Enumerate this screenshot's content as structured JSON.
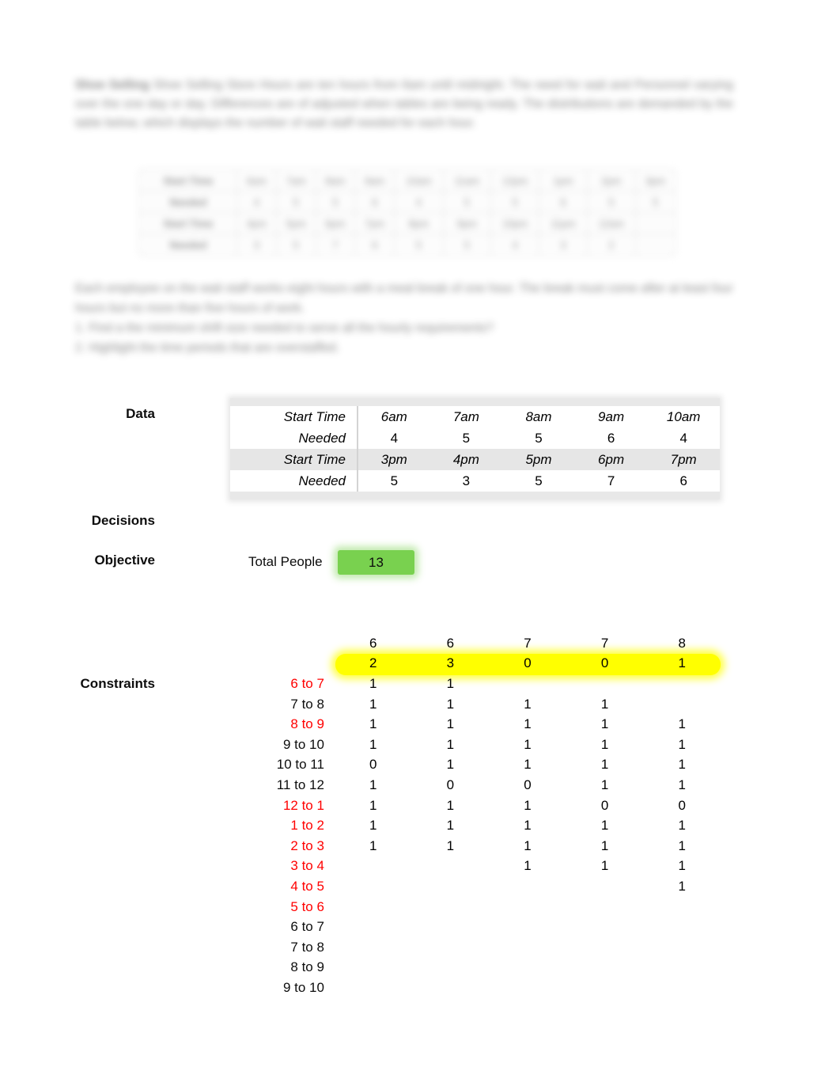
{
  "intro": {
    "lead_bold": "Shoe Selling",
    "paragraph": "Shoe Selling Store Hours are ten hours from 6am until midnight. The need for wait and Personnel varying over the one day or day. Differences are of adjusted when tables are being ready. The distributions are demanded by the table below, which displays the number of wait staff needed for each hour.",
    "questions_paragraph": "Each employee on the wait staff works eight hours with a meal break of one hour. The break must come after at least four hours but no more than five hours of work.",
    "q1": "1. Find a the minimum shift size needed to serve all the hourly requirements?",
    "q2": "2. Highlight the time periods that are overstaffed."
  },
  "blurred_table": {
    "row1_label": "Start Time",
    "row1": [
      "6am",
      "7am",
      "8am",
      "9am",
      "10am",
      "11am",
      "12pm",
      "1pm",
      "2pm",
      "3pm"
    ],
    "row2_label": "Needed",
    "row2": [
      "4",
      "5",
      "5",
      "6",
      "4",
      "5",
      "5",
      "6",
      "5",
      "5"
    ],
    "row3_label": "Start Time",
    "row3": [
      "4pm",
      "5pm",
      "6pm",
      "7pm",
      "8pm",
      "9pm",
      "10pm",
      "11pm",
      "12am"
    ],
    "row4_label": "Needed",
    "row4": [
      "3",
      "5",
      "7",
      "6",
      "5",
      "5",
      "4",
      "3",
      "2"
    ]
  },
  "sections": {
    "data": "Data",
    "decisions": "Decisions",
    "objective": "Objective",
    "constraints": "Constraints"
  },
  "data_table": {
    "rows": [
      {
        "label": "Start Time",
        "band": false,
        "italic_values": true,
        "values": [
          "6am",
          "7am",
          "8am",
          "9am",
          "10am"
        ]
      },
      {
        "label": "Needed",
        "band": false,
        "italic_values": false,
        "values": [
          "4",
          "5",
          "5",
          "6",
          "4"
        ]
      },
      {
        "label": "Start Time",
        "band": true,
        "italic_values": true,
        "values": [
          "3pm",
          "4pm",
          "5pm",
          "6pm",
          "7pm"
        ]
      },
      {
        "label": "Needed",
        "band": false,
        "italic_values": false,
        "values": [
          "5",
          "3",
          "5",
          "7",
          "6"
        ]
      }
    ]
  },
  "objective": {
    "label": "Total People",
    "value": "13",
    "highlight_color": "#79d14f"
  },
  "constraints": {
    "supply_row": [
      "6",
      "6",
      "7",
      "7",
      "8"
    ],
    "decision_row": [
      "2",
      "3",
      "0",
      "0",
      "1"
    ],
    "decision_highlight_color": "#ffff00",
    "red_color": "#ff0000",
    "rows": [
      {
        "label": "6 to 7",
        "red": true,
        "values": [
          "1",
          "1",
          "",
          "",
          ""
        ]
      },
      {
        "label": "7 to 8",
        "red": false,
        "values": [
          "1",
          "1",
          "1",
          "1",
          ""
        ]
      },
      {
        "label": "8 to 9",
        "red": true,
        "values": [
          "1",
          "1",
          "1",
          "1",
          "1"
        ]
      },
      {
        "label": "9 to 10",
        "red": false,
        "values": [
          "1",
          "1",
          "1",
          "1",
          "1"
        ]
      },
      {
        "label": "10 to 11",
        "red": false,
        "values": [
          "0",
          "1",
          "1",
          "1",
          "1"
        ]
      },
      {
        "label": "11 to 12",
        "red": false,
        "values": [
          "1",
          "0",
          "0",
          "1",
          "1"
        ]
      },
      {
        "label": "12 to 1",
        "red": true,
        "values": [
          "1",
          "1",
          "1",
          "0",
          "0"
        ]
      },
      {
        "label": "1 to 2",
        "red": true,
        "values": [
          "1",
          "1",
          "1",
          "1",
          "1"
        ]
      },
      {
        "label": "2 to 3",
        "red": true,
        "values": [
          "1",
          "1",
          "1",
          "1",
          "1"
        ]
      },
      {
        "label": "3 to 4",
        "red": true,
        "values": [
          "",
          "",
          "1",
          "1",
          "1"
        ]
      },
      {
        "label": "4 to 5",
        "red": true,
        "values": [
          "",
          "",
          "",
          "",
          "1"
        ]
      },
      {
        "label": "5 to 6",
        "red": true,
        "values": [
          "",
          "",
          "",
          "",
          ""
        ]
      },
      {
        "label": "6 to 7",
        "red": false,
        "values": [
          "",
          "",
          "",
          "",
          ""
        ]
      },
      {
        "label": "7 to 8",
        "red": false,
        "values": [
          "",
          "",
          "",
          "",
          ""
        ]
      },
      {
        "label": "8 to 9",
        "red": false,
        "values": [
          "",
          "",
          "",
          "",
          ""
        ]
      },
      {
        "label": "9 to 10",
        "red": false,
        "values": [
          "",
          "",
          "",
          "",
          ""
        ]
      }
    ]
  }
}
